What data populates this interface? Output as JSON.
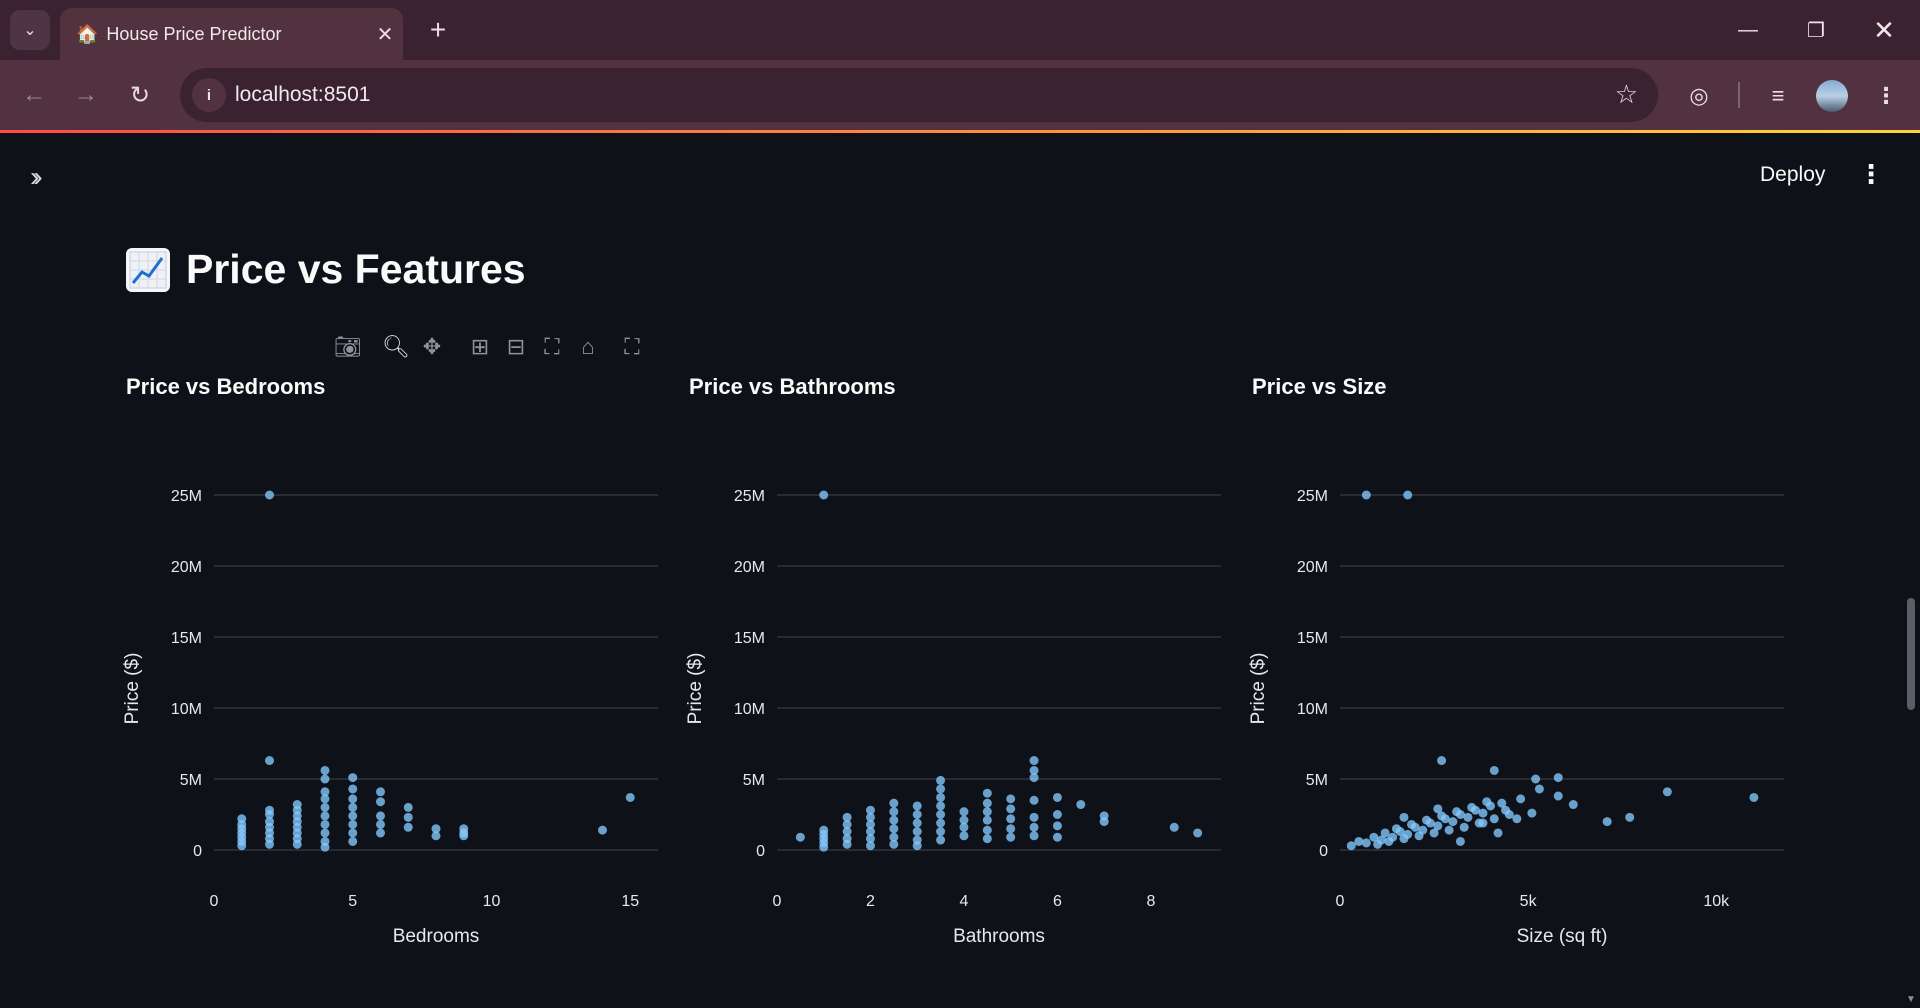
{
  "browser": {
    "tab_title": "House Price Predictor",
    "tab_favicon": "🏠",
    "url": "localhost:8501"
  },
  "app": {
    "deploy_label": "Deploy",
    "page_title": "Price vs Features",
    "page_title_icon": "📈"
  },
  "colors": {
    "background": "#0e1117",
    "marker": "#83c9ff",
    "text": "#fafafa",
    "grid": "#31333f"
  },
  "chart_data": [
    {
      "type": "scatter",
      "title": "Price vs Bedrooms",
      "xlabel": "Bedrooms",
      "ylabel": "Price ($)",
      "xticks": [
        0,
        5,
        10,
        15
      ],
      "xtick_labels": [
        "0",
        "5",
        "10",
        "15"
      ],
      "yticks": [
        0,
        5000000,
        10000000,
        15000000,
        20000000,
        25000000
      ],
      "ytick_labels": [
        "0",
        "5M",
        "10M",
        "15M",
        "20M",
        "25M"
      ],
      "xlim": [
        0,
        16
      ],
      "ylim": [
        0,
        25000000
      ],
      "points": [
        [
          1,
          300000
        ],
        [
          1,
          600000
        ],
        [
          1,
          900000
        ],
        [
          1,
          1200000
        ],
        [
          1,
          1500000
        ],
        [
          1,
          1800000
        ],
        [
          1,
          2200000
        ],
        [
          2,
          25000000
        ],
        [
          2,
          6300000
        ],
        [
          2,
          2800000
        ],
        [
          2,
          2500000
        ],
        [
          2,
          2000000
        ],
        [
          2,
          1600000
        ],
        [
          2,
          1200000
        ],
        [
          2,
          800000
        ],
        [
          2,
          400000
        ],
        [
          3,
          3200000
        ],
        [
          3,
          2800000
        ],
        [
          3,
          2400000
        ],
        [
          3,
          2000000
        ],
        [
          3,
          1600000
        ],
        [
          3,
          1200000
        ],
        [
          3,
          800000
        ],
        [
          3,
          400000
        ],
        [
          4,
          5600000
        ],
        [
          4,
          5000000
        ],
        [
          4,
          4100000
        ],
        [
          4,
          3600000
        ],
        [
          4,
          3000000
        ],
        [
          4,
          2400000
        ],
        [
          4,
          1800000
        ],
        [
          4,
          1200000
        ],
        [
          4,
          600000
        ],
        [
          4,
          200000
        ],
        [
          5,
          5100000
        ],
        [
          5,
          4300000
        ],
        [
          5,
          3600000
        ],
        [
          5,
          3000000
        ],
        [
          5,
          2400000
        ],
        [
          5,
          1800000
        ],
        [
          5,
          1200000
        ],
        [
          5,
          600000
        ],
        [
          6,
          4100000
        ],
        [
          6,
          3400000
        ],
        [
          6,
          2400000
        ],
        [
          6,
          1800000
        ],
        [
          6,
          1200000
        ],
        [
          7,
          3000000
        ],
        [
          7,
          2300000
        ],
        [
          7,
          1600000
        ],
        [
          8,
          1500000
        ],
        [
          8,
          1000000
        ],
        [
          9,
          1500000
        ],
        [
          9,
          1200000
        ],
        [
          9,
          1000000
        ],
        [
          14,
          1400000
        ],
        [
          15,
          3700000
        ]
      ]
    },
    {
      "type": "scatter",
      "title": "Price vs Bathrooms",
      "xlabel": "Bathrooms",
      "ylabel": "Price ($)",
      "xticks": [
        0,
        2,
        4,
        6,
        8
      ],
      "xtick_labels": [
        "0",
        "2",
        "4",
        "6",
        "8"
      ],
      "yticks": [
        0,
        5000000,
        10000000,
        15000000,
        20000000,
        25000000
      ],
      "ytick_labels": [
        "0",
        "5M",
        "10M",
        "15M",
        "20M",
        "25M"
      ],
      "xlim": [
        0,
        9.5
      ],
      "ylim": [
        0,
        25000000
      ],
      "points": [
        [
          0.5,
          900000
        ],
        [
          1,
          25000000
        ],
        [
          1,
          1400000
        ],
        [
          1,
          1100000
        ],
        [
          1,
          800000
        ],
        [
          1,
          500000
        ],
        [
          1,
          200000
        ],
        [
          1.5,
          2300000
        ],
        [
          1.5,
          1800000
        ],
        [
          1.5,
          1300000
        ],
        [
          1.5,
          800000
        ],
        [
          1.5,
          400000
        ],
        [
          2,
          2800000
        ],
        [
          2,
          2300000
        ],
        [
          2,
          1800000
        ],
        [
          2,
          1300000
        ],
        [
          2,
          800000
        ],
        [
          2,
          300000
        ],
        [
          2.5,
          3300000
        ],
        [
          2.5,
          2700000
        ],
        [
          2.5,
          2100000
        ],
        [
          2.5,
          1500000
        ],
        [
          2.5,
          900000
        ],
        [
          2.5,
          400000
        ],
        [
          3,
          3100000
        ],
        [
          3,
          2500000
        ],
        [
          3,
          1900000
        ],
        [
          3,
          1300000
        ],
        [
          3,
          700000
        ],
        [
          3,
          300000
        ],
        [
          3.5,
          4900000
        ],
        [
          3.5,
          4300000
        ],
        [
          3.5,
          3700000
        ],
        [
          3.5,
          3100000
        ],
        [
          3.5,
          2500000
        ],
        [
          3.5,
          1900000
        ],
        [
          3.5,
          1300000
        ],
        [
          3.5,
          700000
        ],
        [
          4,
          2700000
        ],
        [
          4,
          2100000
        ],
        [
          4,
          1600000
        ],
        [
          4,
          1000000
        ],
        [
          4.5,
          4000000
        ],
        [
          4.5,
          3300000
        ],
        [
          4.5,
          2700000
        ],
        [
          4.5,
          2100000
        ],
        [
          4.5,
          1400000
        ],
        [
          4.5,
          800000
        ],
        [
          5,
          3600000
        ],
        [
          5,
          2900000
        ],
        [
          5,
          2200000
        ],
        [
          5,
          1500000
        ],
        [
          5,
          900000
        ],
        [
          5.5,
          6300000
        ],
        [
          5.5,
          5600000
        ],
        [
          5.5,
          5100000
        ],
        [
          5.5,
          3500000
        ],
        [
          5.5,
          2300000
        ],
        [
          5.5,
          1600000
        ],
        [
          5.5,
          1000000
        ],
        [
          6,
          3700000
        ],
        [
          6,
          2500000
        ],
        [
          6,
          1700000
        ],
        [
          6,
          900000
        ],
        [
          6.5,
          3200000
        ],
        [
          7,
          2400000
        ],
        [
          7,
          2000000
        ],
        [
          8.5,
          1600000
        ],
        [
          9,
          1200000
        ]
      ]
    },
    {
      "type": "scatter",
      "title": "Price vs Size",
      "xlabel": "Size (sq ft)",
      "ylabel": "Price ($)",
      "xticks": [
        0,
        5000,
        10000
      ],
      "xtick_labels": [
        "0",
        "5k",
        "10k"
      ],
      "yticks": [
        0,
        5000000,
        10000000,
        15000000,
        20000000,
        25000000
      ],
      "ytick_labels": [
        "0",
        "5M",
        "10M",
        "15M",
        "20M",
        "25M"
      ],
      "xlim": [
        0,
        11800
      ],
      "ylim": [
        0,
        25000000
      ],
      "points": [
        [
          700,
          25000000
        ],
        [
          1800,
          25000000
        ],
        [
          2700,
          6300000
        ],
        [
          4100,
          5600000
        ],
        [
          5200,
          5000000
        ],
        [
          5800,
          5100000
        ],
        [
          6200,
          3200000
        ],
        [
          7100,
          2000000
        ],
        [
          7700,
          2300000
        ],
        [
          8700,
          4100000
        ],
        [
          11000,
          3700000
        ],
        [
          5300,
          4300000
        ],
        [
          5800,
          3800000
        ],
        [
          4800,
          3600000
        ],
        [
          4400,
          2800000
        ],
        [
          4700,
          2200000
        ],
        [
          5100,
          2600000
        ],
        [
          3800,
          1900000
        ],
        [
          4200,
          1200000
        ],
        [
          3200,
          600000
        ],
        [
          300,
          300000
        ],
        [
          500,
          600000
        ],
        [
          700,
          500000
        ],
        [
          900,
          900000
        ],
        [
          1100,
          700000
        ],
        [
          1200,
          1200000
        ],
        [
          1400,
          900000
        ],
        [
          1600,
          1300000
        ],
        [
          1800,
          1100000
        ],
        [
          2000,
          1600000
        ],
        [
          2200,
          1400000
        ],
        [
          2400,
          1900000
        ],
        [
          2600,
          1700000
        ],
        [
          2800,
          2200000
        ],
        [
          3000,
          2000000
        ],
        [
          3200,
          2500000
        ],
        [
          3400,
          2300000
        ],
        [
          3600,
          2800000
        ],
        [
          3800,
          2600000
        ],
        [
          4000,
          3100000
        ],
        [
          1000,
          400000
        ],
        [
          1300,
          600000
        ],
        [
          1700,
          800000
        ],
        [
          2100,
          1000000
        ],
        [
          2500,
          1200000
        ],
        [
          2900,
          1400000
        ],
        [
          3300,
          1600000
        ],
        [
          3700,
          1900000
        ],
        [
          4100,
          2200000
        ],
        [
          1500,
          1500000
        ],
        [
          1900,
          1800000
        ],
        [
          2300,
          2100000
        ],
        [
          2700,
          2400000
        ],
        [
          3100,
          2700000
        ],
        [
          3500,
          3000000
        ],
        [
          1700,
          2300000
        ],
        [
          2600,
          2900000
        ],
        [
          3900,
          3400000
        ],
        [
          4300,
          3300000
        ],
        [
          4500,
          2500000
        ]
      ]
    }
  ]
}
